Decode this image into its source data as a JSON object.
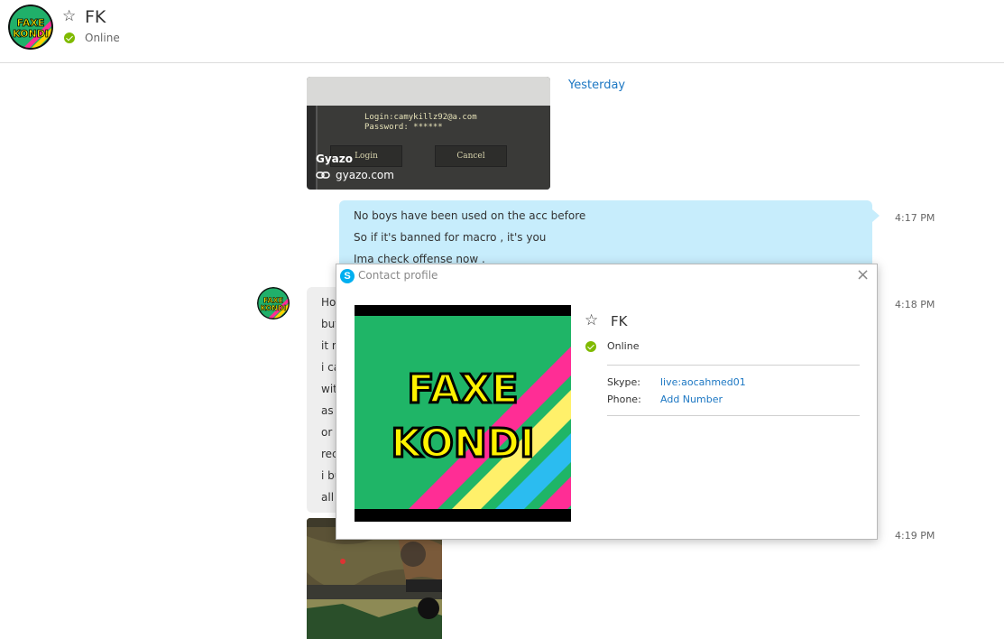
{
  "header": {
    "contact_name": "FK",
    "status": "Online"
  },
  "chat": {
    "day_label": "Yesterday",
    "gyazo_card": {
      "overlay_line1": "Login:camykillz92@a.com",
      "overlay_line2": "Password: ******",
      "button_login": "Login",
      "button_cancel": "Cancel",
      "title": "Gyazo",
      "domain": "gyazo.com"
    },
    "outgoing_message": {
      "lines": [
        "No boys have been used on the acc before",
        "So if it's banned for macro , it's you",
        "Ima check offense now ."
      ],
      "time": "4:17 PM"
    },
    "incoming_message": {
      "lines": [
        "Ho",
        "but",
        "it n",
        "i ca",
        "wit",
        "as",
        "or",
        "rec",
        "i bu",
        "all"
      ],
      "time": "4:18 PM"
    },
    "image_message_time": "4:19 PM"
  },
  "avatar_logo_text": [
    "FAXE",
    "KONDI"
  ],
  "colors": {
    "online_green": "#7fba00",
    "link_blue": "#1c77c3",
    "outgoing_bubble": "#c7edfc",
    "incoming_bubble": "#eeeeee",
    "skype_blue": "#00aff0"
  },
  "profile_dialog": {
    "title": "Contact profile",
    "close_icon": "×",
    "skype_icon": "S",
    "name": "FK",
    "status": "Online",
    "skype_label": "Skype:",
    "skype_value": "live:aocahmed01",
    "phone_label": "Phone:",
    "phone_value": "Add Number"
  }
}
